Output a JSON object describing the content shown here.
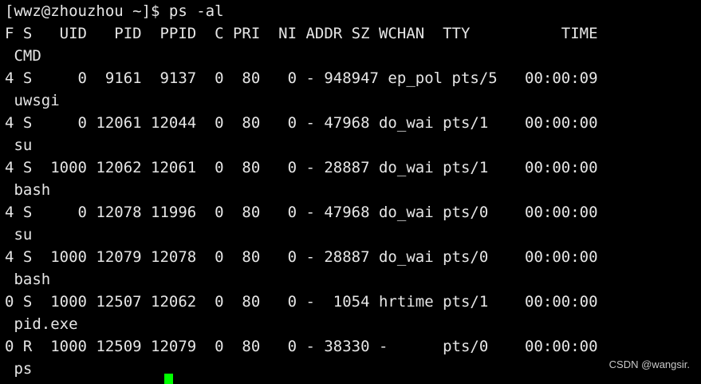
{
  "terminal": {
    "prompt": "[wwz@zhouzhou ~]$ ps -al",
    "header": "F S   UID   PID  PPID  C PRI  NI ADDR SZ WCHAN  TTY          TIME",
    "header_cmd": " CMD",
    "rows": [
      {
        "line": "4 S     0  9161  9137  0  80   0 - 948947 ep_pol pts/5   00:00:09",
        "cmd": " uwsgi"
      },
      {
        "line": "4 S     0 12061 12044  0  80   0 - 47968 do_wai pts/1    00:00:00",
        "cmd": " su"
      },
      {
        "line": "4 S  1000 12062 12061  0  80   0 - 28887 do_wai pts/1    00:00:00",
        "cmd": " bash"
      },
      {
        "line": "4 S     0 12078 11996  0  80   0 - 47968 do_wai pts/0    00:00:00",
        "cmd": " su"
      },
      {
        "line": "4 S  1000 12079 12078  0  80   0 - 28887 do_wai pts/0    00:00:00",
        "cmd": " bash"
      },
      {
        "line": "0 S  1000 12507 12062  0  80   0 -  1054 hrtime pts/1    00:00:00",
        "cmd": " pid.exe"
      },
      {
        "line": "0 R  1000 12509 12079  0  80   0 - 38330 -      pts/0    00:00:00",
        "cmd": " ps"
      }
    ],
    "cursor_color": "#00ff00",
    "background_color": "#000000",
    "text_color": "#e6e6e6"
  },
  "watermark": "CSDN @wangsir."
}
